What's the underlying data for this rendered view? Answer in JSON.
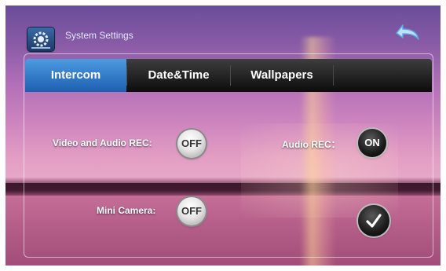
{
  "app": {
    "title": "System Settings"
  },
  "tabs": [
    {
      "label": "Intercom",
      "active": true
    },
    {
      "label": "Date&Time",
      "active": false
    },
    {
      "label": "Wallpapers",
      "active": false
    }
  ],
  "settings": {
    "video_audio_rec": {
      "label": "Video and Audio REC:",
      "state": "OFF"
    },
    "audio_rec": {
      "label": "Audio REC：",
      "state": "ON"
    },
    "mini_camera": {
      "label": "Mini Camera:",
      "state": "OFF"
    }
  },
  "icons": {
    "app": "settings-gear-icon",
    "back": "back-arrow-icon",
    "confirm": "checkmark-icon"
  },
  "colors": {
    "tab_active": "#2a6fc0",
    "tab_bar": "#111111",
    "title_text": "#dfe9ff"
  }
}
